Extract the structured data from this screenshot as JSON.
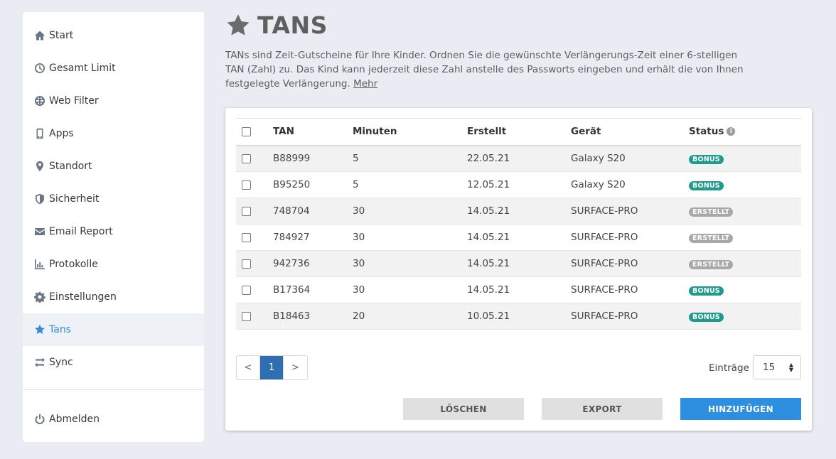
{
  "sidebar": {
    "items": [
      {
        "label": "Start",
        "icon": "home-icon"
      },
      {
        "label": "Gesamt Limit",
        "icon": "clock-icon"
      },
      {
        "label": "Web Filter",
        "icon": "globe-icon"
      },
      {
        "label": "Apps",
        "icon": "phone-icon"
      },
      {
        "label": "Standort",
        "icon": "location-pin-icon"
      },
      {
        "label": "Sicherheit",
        "icon": "shield-icon"
      },
      {
        "label": "Email Report",
        "icon": "envelope-icon"
      },
      {
        "label": "Protokolle",
        "icon": "bar-chart-icon"
      },
      {
        "label": "Einstellungen",
        "icon": "gear-icon"
      },
      {
        "label": "Tans",
        "icon": "star-icon",
        "active": true
      },
      {
        "label": "Sync",
        "icon": "sync-arrows-icon"
      }
    ],
    "logout_label": "Abmelden"
  },
  "page": {
    "title": "TANS",
    "description": "TANs sind Zeit-Gutscheine für Ihre Kinder. Ordnen Sie die gewünschte Verlängerungs-Zeit einer 6-stelligen TAN (Zahl) zu. Das Kind kann jederzeit diese Zahl anstelle des Passworts eingeben und erhält die von Ihnen festgelegte Verlängerung.",
    "more_link": "Mehr"
  },
  "table": {
    "headers": {
      "tan": "TAN",
      "minuten": "Minuten",
      "erstellt": "Erstellt",
      "geraet": "Gerät",
      "status": "Status"
    },
    "rows": [
      {
        "tan": "B88999",
        "minuten": "5",
        "erstellt": "22.05.21",
        "geraet": "Galaxy S20",
        "status": "BONUS"
      },
      {
        "tan": "B95250",
        "minuten": "5",
        "erstellt": "12.05.21",
        "geraet": "Galaxy S20",
        "status": "BONUS"
      },
      {
        "tan": "748704",
        "minuten": "30",
        "erstellt": "14.05.21",
        "geraet": "SURFACE-PRO",
        "status": "ERSTELLT"
      },
      {
        "tan": "784927",
        "minuten": "30",
        "erstellt": "14.05.21",
        "geraet": "SURFACE-PRO",
        "status": "ERSTELLT"
      },
      {
        "tan": "942736",
        "minuten": "30",
        "erstellt": "14.05.21",
        "geraet": "SURFACE-PRO",
        "status": "ERSTELLT"
      },
      {
        "tan": "B17364",
        "minuten": "30",
        "erstellt": "14.05.21",
        "geraet": "SURFACE-PRO",
        "status": "BONUS"
      },
      {
        "tan": "B18463",
        "minuten": "20",
        "erstellt": "10.05.21",
        "geraet": "SURFACE-PRO",
        "status": "BONUS"
      }
    ]
  },
  "pagination": {
    "prev": "<",
    "current": "1",
    "next": ">"
  },
  "entries": {
    "label": "Einträge",
    "value": "15"
  },
  "buttons": {
    "delete": "LÖSCHEN",
    "export": "EXPORT",
    "add": "HINZUFÜGEN"
  },
  "colors": {
    "accent": "#2d8fe0",
    "bonus": "#1f9b8b",
    "erstellt": "#a8a8a8",
    "active_nav": "#3a8ad4"
  }
}
